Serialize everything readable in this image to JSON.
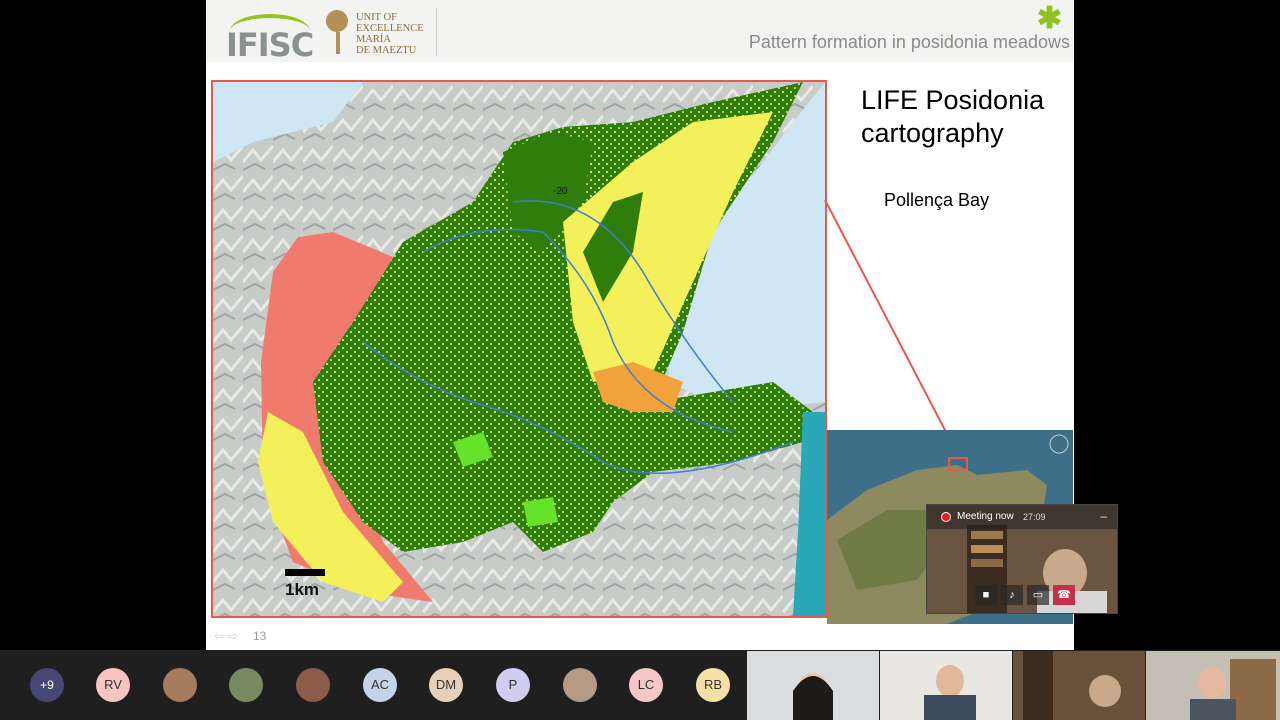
{
  "slide": {
    "header_title": "Pattern formation in posidonia meadows",
    "logo_ifisc": "IFISC",
    "logo_maeztu": "UNIT OF\nEXCELLENCE\nMARÍA\nDE MAEZTU",
    "title": "LIFE Posidonia cartography",
    "subtitle": "Pollença Bay",
    "scale_label": "1km",
    "page_number": "13",
    "map_contour_label": "-20"
  },
  "call_widget": {
    "label": "Meeting now",
    "time": "27:09"
  },
  "participants": {
    "overflow": "+9",
    "avatars": [
      "RV",
      "AC",
      "DM",
      "P",
      "LC",
      "RB"
    ]
  },
  "colors": {
    "posidonia": "#2f7d0c",
    "sand": "#f4f05a",
    "rock": "#f07b6d",
    "accent_border": "#e8584b",
    "leaf_green": "#8fc31f"
  }
}
